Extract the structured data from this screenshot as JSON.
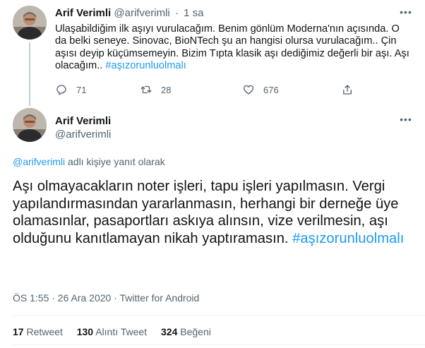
{
  "tweet1": {
    "name": "Arif Verimli",
    "handle": "@arifverimli",
    "separator": "·",
    "time": "1 sa",
    "text": "Ulaşabildiğim ilk aşıyı vurulacağım. Benim gönlüm Moderna'nın açısında. O da belki seneye. Sinovac, BioNTech şu an hangisi olursa vurulacağım.. Çin aşısı deyip küçümsemeyin. Bizim Tıpta klasik aşı dediğimiz değerli bir aşı. Aşı olacağım.. ",
    "hashtag": "#aşızorunluolmalı",
    "replies": "71",
    "retweets": "28",
    "likes": "676"
  },
  "tweet2": {
    "name": "Arif Verimli",
    "handle": "@arifverimli",
    "reply_handle": "@arifverimli",
    "reply_suffix": " adlı kişiye yanıt olarak",
    "text": "Aşı olmayacakların noter işleri, tapu işleri yapılmasın. Vergi yapılandırmasından yararlanmasın, herhangi bir derneğe üye olamasınlar, pasaportları askıya alınsın, vize verilmesin, aşı olduğunu kanıtlamayan nikah yaptıramasın. ",
    "hashtag": "#aşızorunluolmalı",
    "meta": "ÖS 1:55 · 26 Ara 2020 · Twitter for Android",
    "stats": {
      "retweets_count": "17",
      "retweets_label": "Retweet",
      "quotes_count": "130",
      "quotes_label": "Alıntı Tweet",
      "likes_count": "324",
      "likes_label": "Beğeni"
    }
  },
  "icons": {
    "more": "more-dots-icon",
    "reply": "reply-icon",
    "retweet": "retweet-icon",
    "like": "heart-icon",
    "share": "share-icon"
  },
  "colors": {
    "accent": "#1d9bf0",
    "muted": "#536471",
    "text": "#0f1419"
  }
}
